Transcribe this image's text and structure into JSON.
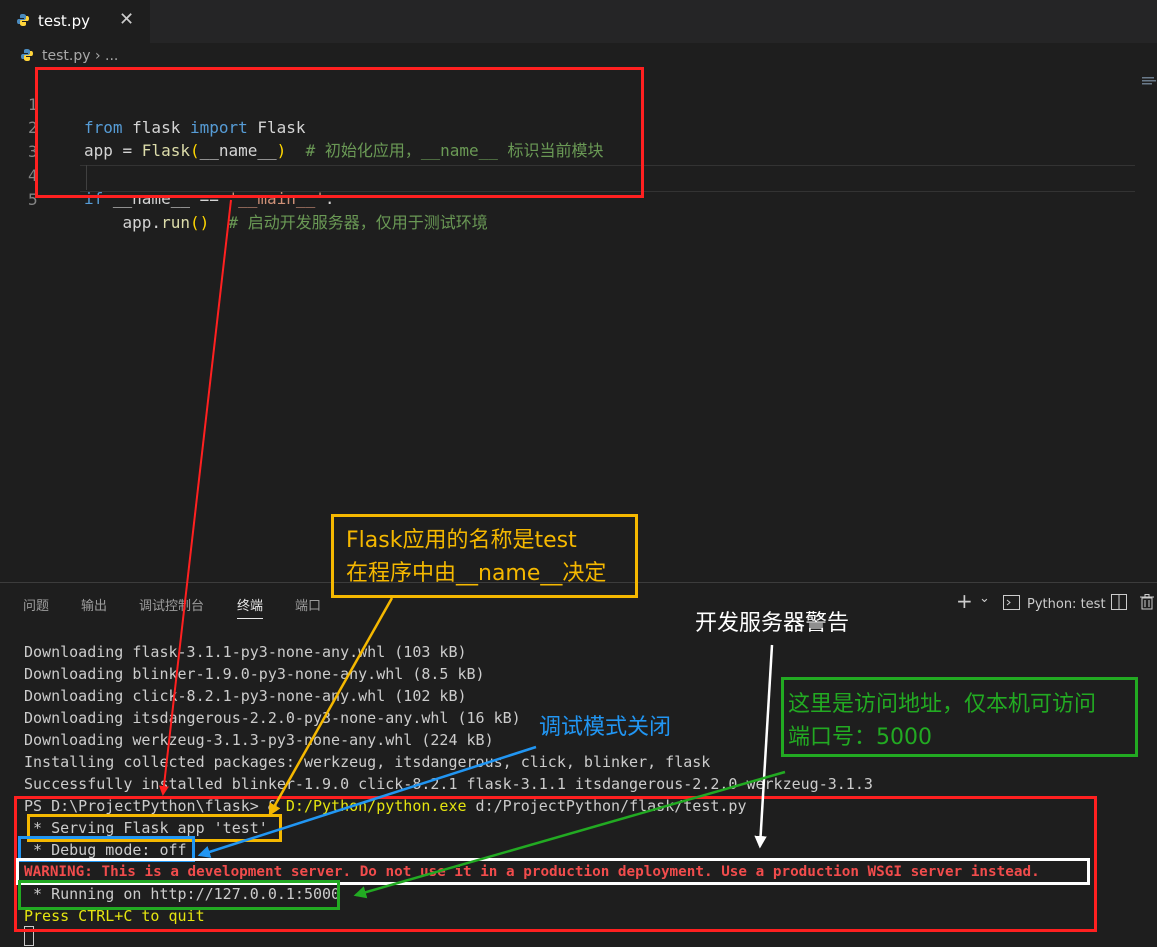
{
  "tab": {
    "label": "test.py",
    "close": "✕"
  },
  "breadcrumb": {
    "file": "test.py",
    "sep": "›",
    "more": "..."
  },
  "code_lines": [
    {
      "n": "1"
    },
    {
      "n": "2"
    },
    {
      "n": "3"
    },
    {
      "n": "4"
    },
    {
      "n": "5"
    }
  ],
  "code": {
    "l1_from": "from",
    "l1_mod": " flask ",
    "l1_import": "import",
    "l1_cls": " Flask",
    "l2_a": "app = ",
    "l2_fn": "Flask",
    "l2_p1": "(",
    "l2_arg": "__name__",
    "l2_p2": ")",
    "l2_cm": "  # 初始化应用，__name__ 标识当前模块",
    "l4_if": "if",
    "l4_a": " __name__ == ",
    "l4_str": "'__main__'",
    "l4_b": ":",
    "l5_a": "    app.",
    "l5_fn": "run",
    "l5_p": "()",
    "l5_cm": "  # 启动开发服务器，仅用于测试环境"
  },
  "panel_tabs": [
    "问题",
    "输出",
    "调试控制台",
    "终端",
    "端口"
  ],
  "panel_right": {
    "plus": "+",
    "chev": "⌄",
    "shell": "Python: test",
    "split": "◫",
    "trash": "🗑"
  },
  "terminal": [
    "Downloading flask-3.1.1-py3-none-any.whl (103 kB)",
    "Downloading blinker-1.9.0-py3-none-any.whl (8.5 kB)",
    "Downloading click-8.2.1-py3-none-any.whl (102 kB)",
    "Downloading itsdangerous-2.2.0-py3-none-any.whl (16 kB)",
    "Downloading werkzeug-3.1.3-py3-none-any.whl (224 kB)",
    "Installing collected packages: werkzeug, itsdangerous, click, blinker, flask",
    "Successfully installed blinker-1.9.0 click-8.2.1 flask-3.1.1 itsdangerous-2.2.0 werkzeug-3.1.3"
  ],
  "prompt": {
    "ps": "PS D:\\ProjectPython\\flask> ",
    "amp": "& ",
    "exe": "D:/Python/python.exe",
    "arg": " d:/ProjectPython/flask/test.py"
  },
  "serving": " * Serving Flask app 'test'",
  "debug": " * Debug mode: off",
  "warning": "WARNING: This is a development server. Do not use it in a production deployment. Use a production WSGI server instead.",
  "running": " * Running on http://127.0.0.1:5000",
  "quit": "Press CTRL+C to quit",
  "annotations": {
    "app_name_l1": "Flask应用的名称是test",
    "app_name_l2": "在程序中由__name__决定",
    "dev_warning": "开发服务器警告",
    "debug_off": "调试模式关闭",
    "address_l1": "这里是访问地址，仅本机可访问",
    "address_l2": "端口号：5000"
  },
  "colors": {
    "red": "#ff2020",
    "orange": "#f5b800",
    "blue": "#2196f3",
    "green": "#22aa22",
    "white": "#ffffff"
  }
}
